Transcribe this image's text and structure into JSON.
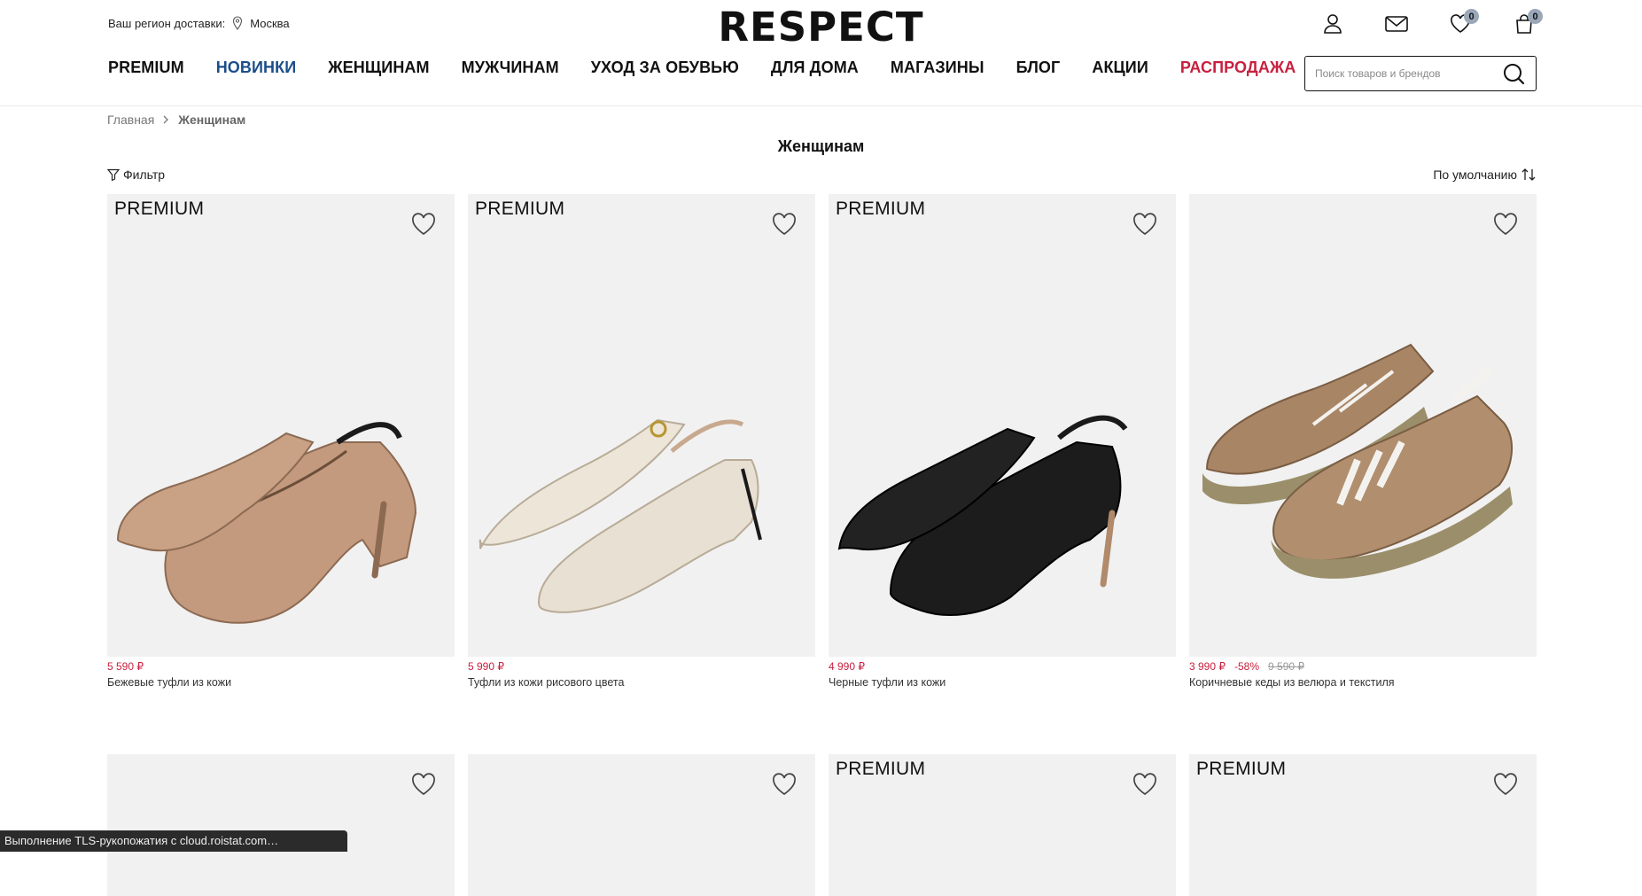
{
  "header": {
    "region_label": "Ваш регион доставки:",
    "region_city": "Москва",
    "logo": "RESPECT",
    "favorites_count": "0",
    "cart_count": "0",
    "search_placeholder": "Поиск товаров и брендов"
  },
  "nav": [
    {
      "label": "PREMIUM",
      "style": "normal"
    },
    {
      "label": "НОВИНКИ",
      "style": "blue"
    },
    {
      "label": "ЖЕНЩИНАМ",
      "style": "normal"
    },
    {
      "label": "МУЖЧИНАМ",
      "style": "normal"
    },
    {
      "label": "УХОД ЗА ОБУВЬЮ",
      "style": "normal"
    },
    {
      "label": "ДЛЯ ДОМА",
      "style": "normal"
    },
    {
      "label": "МАГАЗИНЫ",
      "style": "normal"
    },
    {
      "label": "БЛОГ",
      "style": "normal"
    },
    {
      "label": "АКЦИИ",
      "style": "normal"
    },
    {
      "label": "РАСПРОДАЖА",
      "style": "red"
    }
  ],
  "breadcrumb": {
    "home": "Главная",
    "current": "Женщинам"
  },
  "page_title": "Женщинам",
  "toolbar": {
    "filter_label": "Фильтр",
    "sort_label": "По умолчанию"
  },
  "colors": {
    "accent_blue": "#1b4e8a",
    "sale_red": "#c8203f",
    "card_bg": "#f1f1f1",
    "badge": "#9aa7b8"
  },
  "products": [
    {
      "tag": "PREMIUM",
      "price": "5 590 ₽",
      "discount": "",
      "old_price": "",
      "name": "Бежевые туфли из кожи",
      "shoe_color": "#c49a7e"
    },
    {
      "tag": "PREMIUM",
      "price": "5 990 ₽",
      "discount": "",
      "old_price": "",
      "name": "Туфли из кожи рисового цвета",
      "shoe_color": "#e8e0d2"
    },
    {
      "tag": "PREMIUM",
      "price": "4 990 ₽",
      "discount": "",
      "old_price": "",
      "name": "Черные туфли из кожи",
      "shoe_color": "#1c1c1c"
    },
    {
      "tag": "",
      "price": "3 990 ₽",
      "discount": "-58%",
      "old_price": "9 590 ₽",
      "name": "Коричневые кеды из велюра и текстиля",
      "shoe_color": "#a88565"
    }
  ],
  "products_row2": [
    {
      "tag": ""
    },
    {
      "tag": ""
    },
    {
      "tag": "PREMIUM"
    },
    {
      "tag": "PREMIUM"
    }
  ],
  "status_bar": "Выполнение TLS-рукопожатия с cloud.roistat.com…"
}
